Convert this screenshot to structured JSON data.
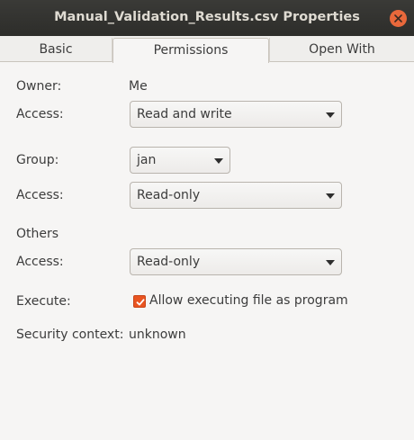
{
  "window": {
    "title": "Manual_Validation_Results.csv Properties",
    "close_icon": "close-icon",
    "accent_color": "#e95420"
  },
  "tabs": [
    {
      "label": "Basic",
      "selected": false
    },
    {
      "label": "Permissions",
      "selected": true
    },
    {
      "label": "Open With",
      "selected": false
    }
  ],
  "permissions": {
    "owner_label": "Owner:",
    "owner_value": "Me",
    "owner_access_label": "Access:",
    "owner_access_value": "Read and write",
    "group_label": "Group:",
    "group_value": "jan",
    "group_access_label": "Access:",
    "group_access_value": "Read-only",
    "others_label": "Others",
    "others_access_label": "Access:",
    "others_access_value": "Read-only",
    "execute_label": "Execute:",
    "execute_checkbox_label": "Allow executing file as program",
    "execute_checked": true,
    "security_label": "Security context:",
    "security_value": "unknown"
  }
}
